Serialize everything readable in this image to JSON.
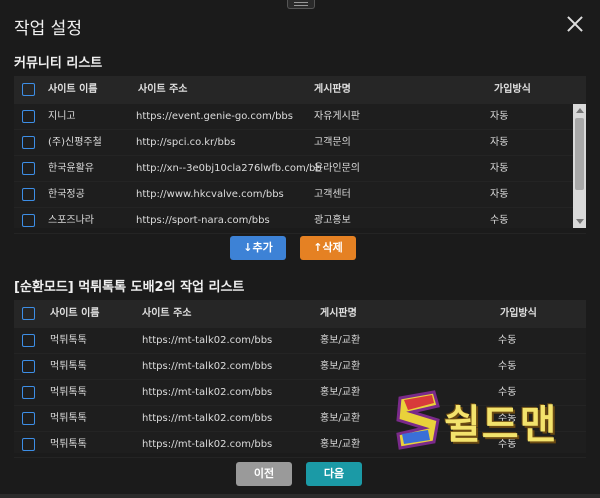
{
  "dialog": {
    "title": "작업 설정",
    "close_icon": "close-icon"
  },
  "community": {
    "title": "커뮤니티 리스트",
    "columns": [
      "사이트 이름",
      "사이트 주소",
      "게시판명",
      "가입방식"
    ],
    "rows": [
      {
        "name": "지니고",
        "url": "https://event.genie-go.com/bbs",
        "board": "자유게시판",
        "join": "자동"
      },
      {
        "name": "(주)신평주철",
        "url": "http://spci.co.kr/bbs",
        "board": "고객문의",
        "join": "자동"
      },
      {
        "name": "한국윤활유",
        "url": "http://xn--3e0bj10cla276lwfb.com/bb",
        "board": "온라인문의",
        "join": "자동"
      },
      {
        "name": "한국정공",
        "url": "http://www.hkcvalve.com/bbs",
        "board": "고객센터",
        "join": "자동"
      },
      {
        "name": "스포즈나라",
        "url": "https://sport-nara.com/bbs",
        "board": "광고홍보",
        "join": "수동"
      }
    ]
  },
  "actions": {
    "add_label": "↓추가",
    "delete_label": "↑삭제"
  },
  "worklist": {
    "title": "[순환모드] 먹튀톡톡 도배2의 작업 리스트",
    "columns": [
      "사이트 이름",
      "사이트 주소",
      "게시판명",
      "가입방식"
    ],
    "rows": [
      {
        "name": "먹튀톡톡",
        "url": "https://mt-talk02.com/bbs",
        "board": "홍보/교환",
        "join": "수동"
      },
      {
        "name": "먹튀톡톡",
        "url": "https://mt-talk02.com/bbs",
        "board": "홍보/교환",
        "join": "수동"
      },
      {
        "name": "먹튀톡톡",
        "url": "https://mt-talk02.com/bbs",
        "board": "홍보/교환",
        "join": "수동"
      },
      {
        "name": "먹튀톡톡",
        "url": "https://mt-talk02.com/bbs",
        "board": "홍보/교환",
        "join": "수동"
      },
      {
        "name": "먹튀톡톡",
        "url": "https://mt-talk02.com/bbs",
        "board": "홍보/교환",
        "join": "수동"
      }
    ]
  },
  "footer": {
    "prev_label": "이전",
    "next_label": "다음"
  },
  "watermark": {
    "text": "쉴드맨"
  },
  "colors": {
    "background": "#1b1b1b",
    "accent_blue": "#3d82d6",
    "accent_orange": "#e58123",
    "accent_teal": "#1b9aa6",
    "checkbox": "#3d8ee6"
  }
}
